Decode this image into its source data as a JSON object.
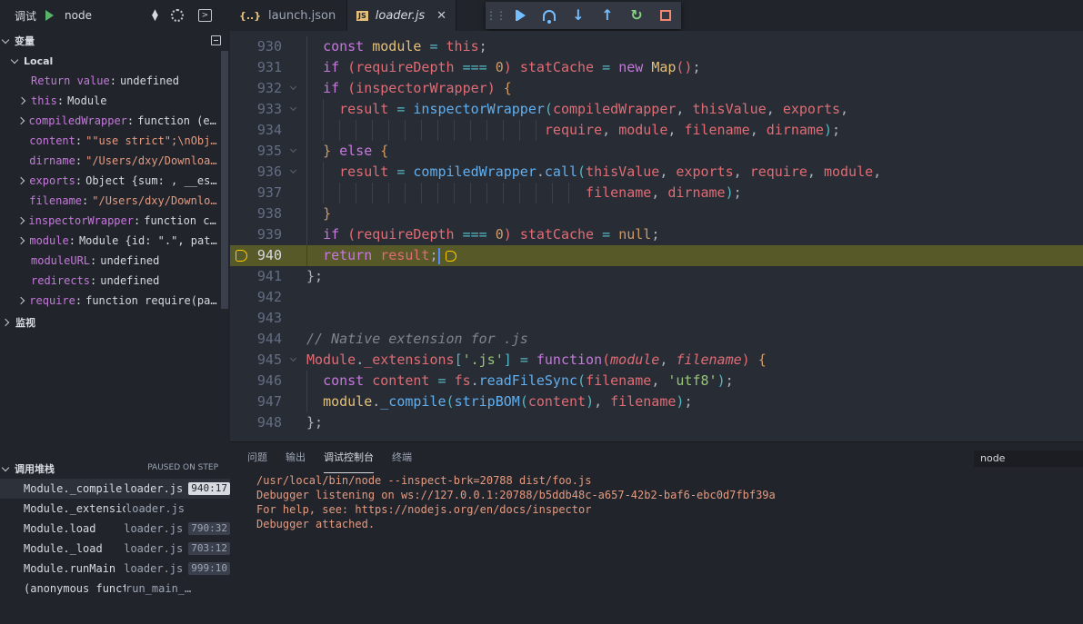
{
  "sidebar": {
    "debug_label": "调试",
    "config_name": "node",
    "sections": {
      "variables": "变量",
      "local": "Local",
      "watch": "监视",
      "call_stack": "调用堆栈",
      "paused_status": "PAUSED ON STEP"
    },
    "variables": [
      {
        "name": "Return value",
        "value": "undefined",
        "expandable": false,
        "string": false
      },
      {
        "name": "this",
        "value": "Module",
        "expandable": true,
        "string": false
      },
      {
        "name": "compiledWrapper",
        "value": "function (expor…",
        "expandable": true,
        "string": false
      },
      {
        "name": "content",
        "value": "\"\"use strict\";\\nObject.…",
        "expandable": false,
        "string": true
      },
      {
        "name": "dirname",
        "value": "\"/Users/dxy/Downloads/t…",
        "expandable": false,
        "string": true
      },
      {
        "name": "exports",
        "value": "Object {sum: , __esModu…",
        "expandable": true,
        "string": false
      },
      {
        "name": "filename",
        "value": "\"/Users/dxy/Downloads/…",
        "expandable": false,
        "string": true
      },
      {
        "name": "inspectorWrapper",
        "value": "function callA…",
        "expandable": true,
        "string": false
      },
      {
        "name": "module",
        "value": "Module {id: \".\", path: \"…",
        "expandable": true,
        "string": false
      },
      {
        "name": "moduleURL",
        "value": "undefined",
        "expandable": false,
        "string": false
      },
      {
        "name": "redirects",
        "value": "undefined",
        "expandable": false,
        "string": false
      },
      {
        "name": "require",
        "value": "function require(path) …",
        "expandable": true,
        "string": false
      }
    ],
    "call_stack": [
      {
        "fn": "Module._compile",
        "file": "loader.js",
        "pos": "940:17",
        "active": true
      },
      {
        "fn": "Module._extensions..js",
        "file": "loader.js",
        "pos": "",
        "active": false
      },
      {
        "fn": "Module.load",
        "file": "loader.js",
        "pos": "790:32",
        "active": false
      },
      {
        "fn": "Module._load",
        "file": "loader.js",
        "pos": "703:12",
        "active": false
      },
      {
        "fn": "Module.runMain",
        "file": "loader.js",
        "pos": "999:10",
        "active": false
      },
      {
        "fn": "(anonymous function)",
        "file": "run_main_…",
        "pos": "",
        "active": false
      }
    ]
  },
  "tabs": [
    {
      "label": "launch.json",
      "icon": "{..}",
      "active": false
    },
    {
      "label": "loader.js",
      "icon": "JS",
      "active": true
    }
  ],
  "debug_toolbar": [
    "continue",
    "step-over",
    "step-into",
    "step-out",
    "restart",
    "stop"
  ],
  "editor": {
    "current_line": 940,
    "lines": [
      {
        "n": "930"
      },
      {
        "n": "931"
      },
      {
        "n": "932"
      },
      {
        "n": "933"
      },
      {
        "n": "934"
      },
      {
        "n": "935"
      },
      {
        "n": "936"
      },
      {
        "n": "937"
      },
      {
        "n": "938"
      },
      {
        "n": "939"
      },
      {
        "n": "940"
      },
      {
        "n": "941"
      },
      {
        "n": "942"
      },
      {
        "n": "943"
      },
      {
        "n": "944"
      },
      {
        "n": "945"
      },
      {
        "n": "946"
      },
      {
        "n": "947"
      },
      {
        "n": "948"
      }
    ]
  },
  "panel": {
    "tabs": [
      "问题",
      "输出",
      "调试控制台",
      "终端"
    ],
    "active_tab": "调试控制台",
    "filter_value": "node",
    "console": [
      "/usr/local/bin/node --inspect-brk=20788 dist/foo.js",
      "Debugger listening on ws://127.0.0.1:20788/b5ddb48c-a657-42b2-baf6-ebc0d7fbf39a",
      "For help, see: https://nodejs.org/en/docs/inspector",
      "Debugger attached."
    ]
  },
  "colors": {
    "accent": "#75beff",
    "highlight_line": "#575929",
    "breakpoint": "#ffcc00"
  }
}
